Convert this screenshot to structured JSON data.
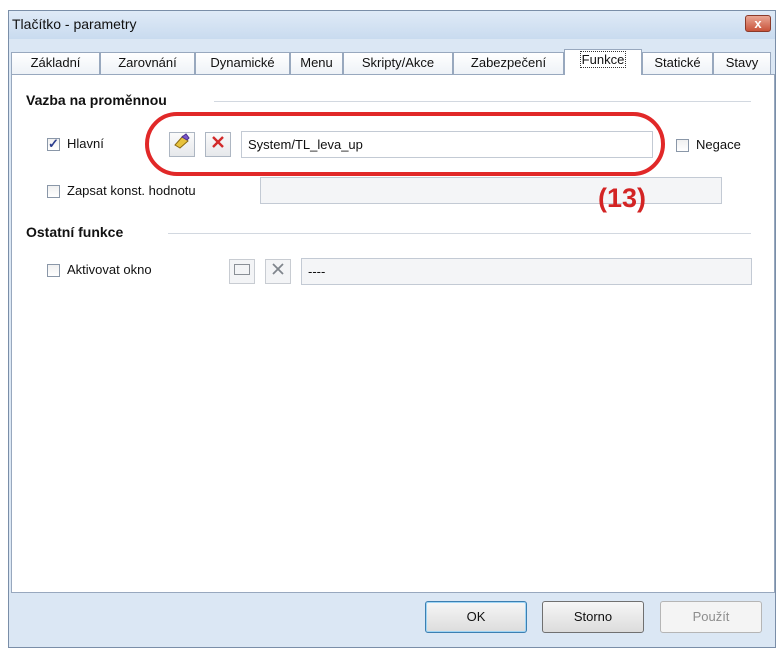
{
  "window": {
    "title": "Tlačítko - parametry",
    "close_glyph": "x"
  },
  "tabs": [
    {
      "label": "Základní"
    },
    {
      "label": "Zarovnání"
    },
    {
      "label": "Dynamické"
    },
    {
      "label": "Menu"
    },
    {
      "label": "Skripty/Akce"
    },
    {
      "label": "Zabezpečení"
    },
    {
      "label": "Funkce",
      "active": true
    },
    {
      "label": "Statické"
    },
    {
      "label": "Stavy"
    }
  ],
  "binding": {
    "group_title": "Vazba na proměnnou",
    "main_label": "Hlavní",
    "main_checked": true,
    "variable_value": "System/TL_leva_up",
    "negate_label": "Negace",
    "negate_checked": false,
    "write_const_label": "Zapsat konst. hodnotu",
    "write_const_checked": false,
    "const_value": ""
  },
  "other": {
    "group_title": "Ostatní funkce",
    "activate_label": "Aktivovat okno",
    "activate_checked": false,
    "window_value": "----"
  },
  "annotation": {
    "label": "(13)",
    "color": "#e12828"
  },
  "buttons": {
    "ok": "OK",
    "cancel": "Storno",
    "apply": "Použít"
  },
  "icons": {
    "select_variable": "pencil-tag-icon",
    "clear_variable": "red-x-icon",
    "window_select": "window-icon",
    "clear_window": "x-icon"
  }
}
